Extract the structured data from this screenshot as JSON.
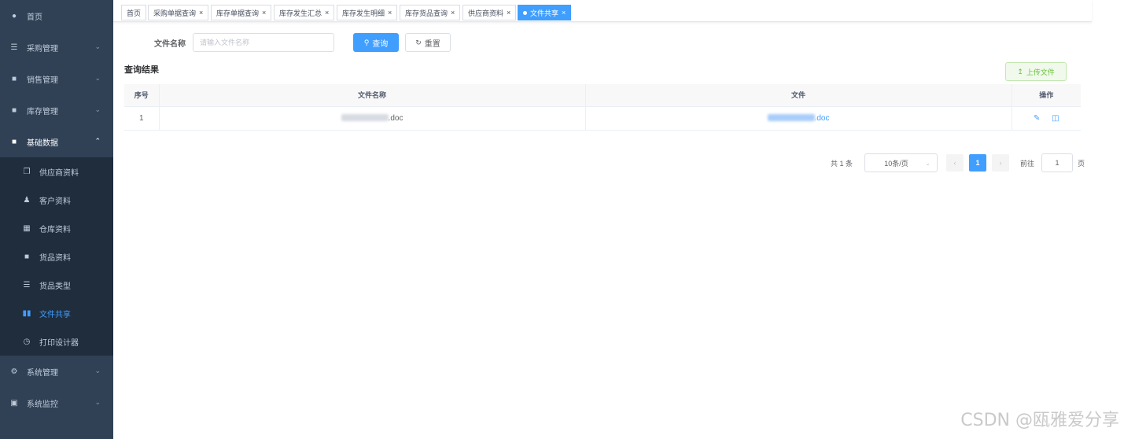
{
  "sidebar": {
    "items": [
      {
        "label": "首页",
        "icon": "dashboard-icon",
        "expandable": false
      },
      {
        "label": "采购管理",
        "icon": "cart-icon",
        "expandable": true
      },
      {
        "label": "销售管理",
        "icon": "document-icon",
        "expandable": true
      },
      {
        "label": "库存管理",
        "icon": "inventory-icon",
        "expandable": true
      },
      {
        "label": "基础数据",
        "icon": "data-icon",
        "expandable": true,
        "open": true
      }
    ],
    "sub_items": [
      {
        "label": "供应商资料",
        "icon": "copy-icon"
      },
      {
        "label": "客户资料",
        "icon": "user-icon"
      },
      {
        "label": "仓库资料",
        "icon": "warehouse-icon"
      },
      {
        "label": "货品资料",
        "icon": "goods-icon"
      },
      {
        "label": "货品类型",
        "icon": "list-icon"
      },
      {
        "label": "文件共享",
        "icon": "book-icon",
        "active": true
      },
      {
        "label": "打印设计器",
        "icon": "print-icon"
      }
    ],
    "bottom_items": [
      {
        "label": "系统管理",
        "icon": "gear-icon",
        "expandable": true
      },
      {
        "label": "系统监控",
        "icon": "monitor-icon",
        "expandable": true
      }
    ]
  },
  "tags": [
    {
      "label": "首页",
      "closable": false
    },
    {
      "label": "采购单据查询",
      "closable": true
    },
    {
      "label": "库存单据查询",
      "closable": true
    },
    {
      "label": "库存发生汇总",
      "closable": true
    },
    {
      "label": "库存发生明细",
      "closable": true
    },
    {
      "label": "库存货品查询",
      "closable": true
    },
    {
      "label": "供应商资料",
      "closable": true
    },
    {
      "label": "文件共享",
      "closable": true,
      "active": true
    }
  ],
  "search": {
    "label": "文件名称",
    "placeholder": "请输入文件名称",
    "value": "",
    "query_label": "查询",
    "reset_label": "重置"
  },
  "result_title": "查询结果",
  "upload_label": "上传文件",
  "table": {
    "columns": [
      "序号",
      "文件名称",
      "文件",
      "操作"
    ],
    "rows": [
      {
        "index": "1",
        "name_suffix": ".doc",
        "file_suffix": ".doc"
      }
    ]
  },
  "pagination": {
    "total_text": "共 1 条",
    "page_size": "10条/页",
    "current_page": "1",
    "goto_label": "前往",
    "goto_value": "1",
    "page_unit": "页"
  },
  "watermark": "CSDN @瓯雅爱分享",
  "colors": {
    "sidebar_bg": "#304156",
    "primary": "#409eff",
    "success": "#67c23a"
  }
}
